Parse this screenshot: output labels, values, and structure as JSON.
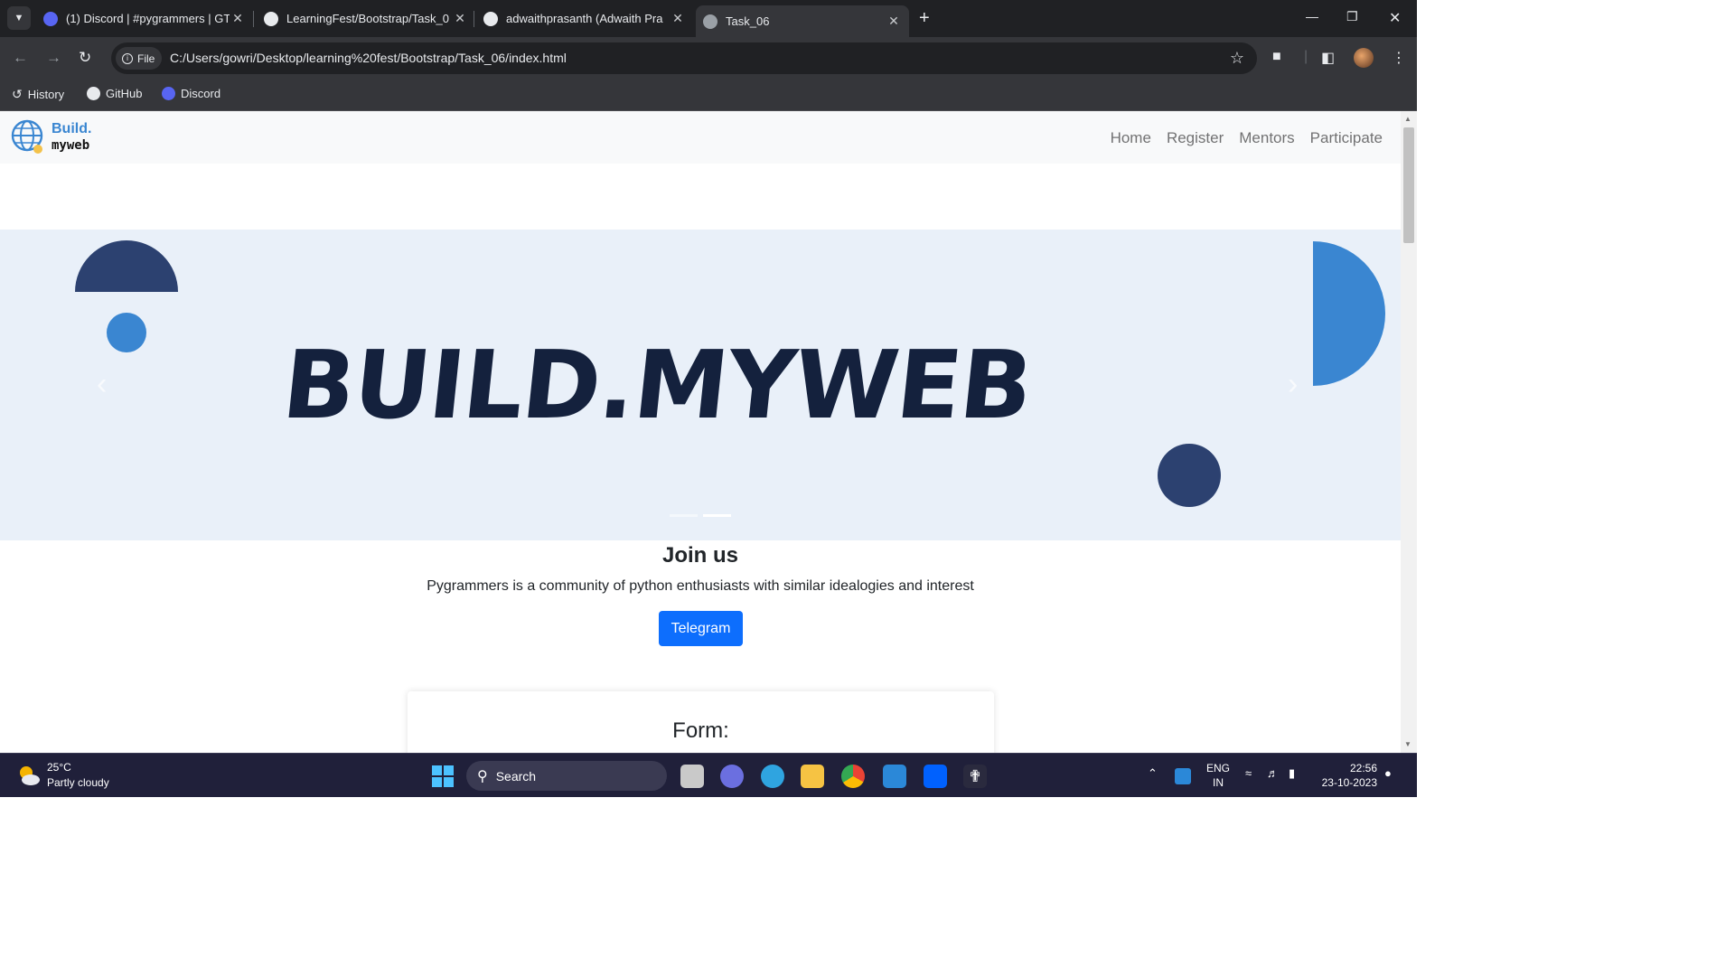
{
  "browser": {
    "tabs": [
      {
        "title": "(1) Discord | #pygrammers | GT",
        "active": false
      },
      {
        "title": "LearningFest/Bootstrap/Task_0",
        "active": false
      },
      {
        "title": "adwaithprasanth (Adwaith Pra",
        "active": false
      },
      {
        "title": "Task_06",
        "active": true
      }
    ],
    "omnibox": {
      "chip": "File",
      "url": "C:/Users/gowri/Desktop/learning%20fest/Bootstrap/Task_06/index.html"
    },
    "bookmarks": [
      "History",
      "GitHub",
      "Discord"
    ]
  },
  "site": {
    "logo": {
      "line1": "Build.",
      "line2": "myweb"
    },
    "nav": [
      "Home",
      "Register",
      "Mentors",
      "Participate"
    ],
    "carousel": {
      "headline": "BUILD.MYWEB",
      "slide_count": 2,
      "active_slide": 2,
      "background": "#e9f0f9",
      "shape_colors": {
        "dark": "#2c4170",
        "light": "#3a86d1"
      }
    },
    "join": {
      "title": "Join us",
      "text": "Pygrammers is a community of python enthusiasts with similar idealogies and interest",
      "button": "Telegram"
    },
    "form": {
      "title": "Form:"
    },
    "accent": "#0d6efd"
  },
  "taskbar": {
    "weather": {
      "temp": "25°C",
      "desc": "Partly cloudy"
    },
    "search": "Search",
    "lang": {
      "line1": "ENG",
      "line2": "IN"
    },
    "clock": {
      "time": "22:56",
      "date": "23-10-2023"
    }
  }
}
